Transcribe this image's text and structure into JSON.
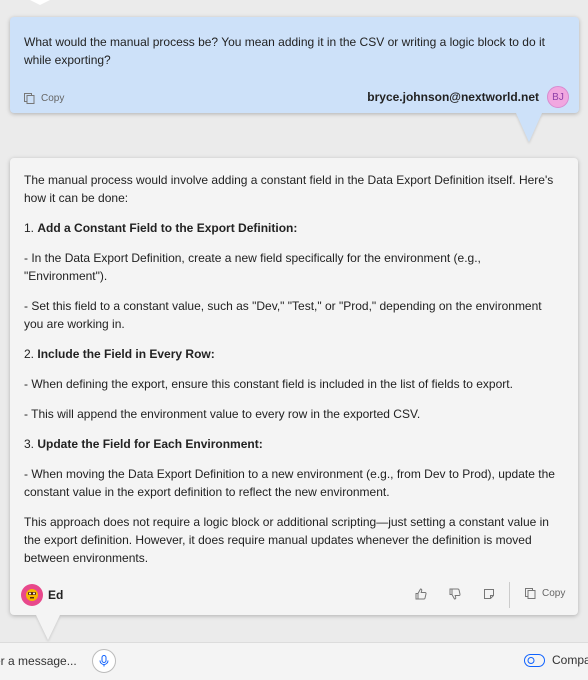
{
  "user_message": {
    "text": "What would the manual process be? You mean adding it in the CSV or writing a logic block to do it while exporting?",
    "copy_label": "Copy",
    "email": "bryce.johnson@nextworld.net",
    "avatar_initials": "BJ"
  },
  "bot_message": {
    "intro": "The manual process would involve adding a constant field in the Data Export Definition itself. Here's how it can be done:",
    "step1_num": "1.",
    "step1_title": "Add a Constant Field to the Export Definition:",
    "step1_b1": "- In the Data Export Definition, create a new field specifically for the environment (e.g., \"Environment\").",
    "step1_b2": "- Set this field to a constant value, such as \"Dev,\" \"Test,\" or \"Prod,\" depending on the environment you are working in.",
    "step2_num": "2.",
    "step2_title": "Include the Field in Every Row:",
    "step2_b1": "- When defining the export, ensure this constant field is included in the list of fields to export.",
    "step2_b2": "- This will append the environment value to every row in the exported CSV.",
    "step3_num": "3.",
    "step3_title": "Update the Field for Each Environment:",
    "step3_b1": "- When moving the Data Export Definition to a new environment (e.g., from Dev to Prod), update the constant value in the export definition to reflect the new environment.",
    "conclusion": "This approach does not require a logic block or additional scripting—just setting a constant value in the export definition. However, it does require manual updates whenever the definition is moved between environments.",
    "sender": "Ed",
    "copy_label": "Copy"
  },
  "input_bar": {
    "placeholder": "Enter a message...",
    "compact_label": "Compact"
  },
  "icons": {
    "copy": "copy-icon",
    "thumbs_up": "thumbs-up-icon",
    "thumbs_down": "thumbs-down-icon",
    "note": "note-icon",
    "microphone": "microphone-icon",
    "toggle": "toggle-icon"
  },
  "colors": {
    "user_bubble": "#cde1f9",
    "bot_bubble": "#f4f4f4",
    "avatar_user": "#f1a7e0",
    "avatar_bot": "#e8488b",
    "toggle_accent": "#0f62fe"
  }
}
